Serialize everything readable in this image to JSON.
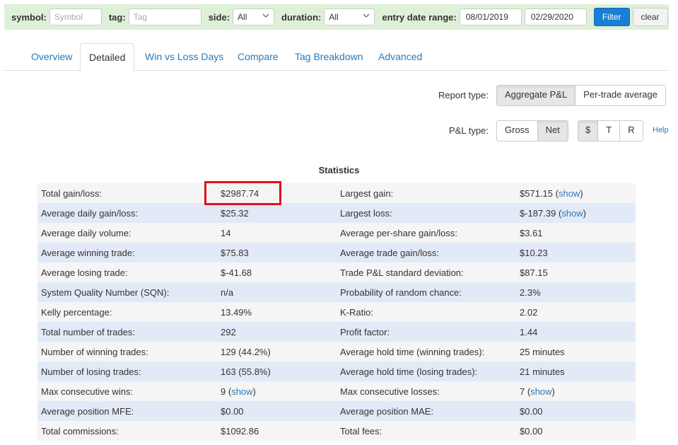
{
  "filters": {
    "symbol_label": "symbol:",
    "symbol_placeholder": "Symbol",
    "tag_label": "tag:",
    "tag_placeholder": "Tag",
    "side_label": "side:",
    "side_value": "All",
    "duration_label": "duration:",
    "duration_value": "All",
    "date_range_label": "entry date range:",
    "date_from": "08/01/2019",
    "date_to": "02/29/2020",
    "filter_button": "Filter",
    "clear_button": "clear"
  },
  "tabs": [
    {
      "label": "Overview",
      "active": false
    },
    {
      "label": "Detailed",
      "active": true
    },
    {
      "label": "Win vs Loss Days",
      "active": false
    },
    {
      "label": "Compare",
      "active": false
    },
    {
      "label": "Tag Breakdown",
      "active": false
    },
    {
      "label": "Advanced",
      "active": false
    }
  ],
  "report_type": {
    "label": "Report type:",
    "options": [
      "Aggregate P&L",
      "Per-trade average"
    ],
    "selected": "Aggregate P&L"
  },
  "pl_type": {
    "label": "P&L type:",
    "options": [
      "Gross",
      "Net"
    ],
    "selected": "Net",
    "unit_options": [
      "$",
      "T",
      "R"
    ],
    "unit_selected": "$",
    "help": "Help"
  },
  "statistics": {
    "title": "Statistics",
    "rows": [
      {
        "l1": "Total gain/loss:",
        "v1": "$2987.74",
        "l2": "Largest gain:",
        "v2": "$571.15",
        "v2_link": "show"
      },
      {
        "l1": "Average daily gain/loss:",
        "v1": "$25.32",
        "l2": "Largest loss:",
        "v2": "$-187.39",
        "v2_link": "show"
      },
      {
        "l1": "Average daily volume:",
        "v1": "14",
        "l2": "Average per-share gain/loss:",
        "v2": "$3.61"
      },
      {
        "l1": "Average winning trade:",
        "v1": "$75.83",
        "l2": "Average trade gain/loss:",
        "v2": "$10.23"
      },
      {
        "l1": "Average losing trade:",
        "v1": "$-41.68",
        "l2": "Trade P&L standard deviation:",
        "v2": "$87.15"
      },
      {
        "l1": "System Quality Number (SQN):",
        "v1": "n/a",
        "l2": "Probability of random chance:",
        "v2": "2.3%"
      },
      {
        "l1": "Kelly percentage:",
        "v1": "13.49%",
        "l2": "K-Ratio:",
        "v2": "2.02"
      },
      {
        "l1": "Total number of trades:",
        "v1": "292",
        "l2": "Profit factor:",
        "v2": "1.44"
      },
      {
        "l1": "Number of winning trades:",
        "v1": "129 (44.2%)",
        "l2": "Average hold time (winning trades):",
        "v2": "25 minutes"
      },
      {
        "l1": "Number of losing trades:",
        "v1": "163 (55.8%)",
        "l2": "Average hold time (losing trades):",
        "v2": "21 minutes"
      },
      {
        "l1": "Max consecutive wins:",
        "v1": "9",
        "v1_link": "show",
        "l2": "Max consecutive losses:",
        "v2": "7",
        "v2_link": "show"
      },
      {
        "l1": "Average position MFE:",
        "v1": "$0.00",
        "l2": "Average position MAE:",
        "v2": "$0.00"
      },
      {
        "l1": "Total commissions:",
        "v1": "$1092.86",
        "l2": "Total fees:",
        "v2": "$0.00"
      }
    ]
  },
  "colors": {
    "filter_bar_bg": "#dff0d8",
    "accent_blue": "#1a7fd4",
    "link_blue": "#2a7ab8",
    "row_odd": "#f5f5f5",
    "row_even": "#e3eaf7",
    "highlight_red": "#e0101a"
  }
}
